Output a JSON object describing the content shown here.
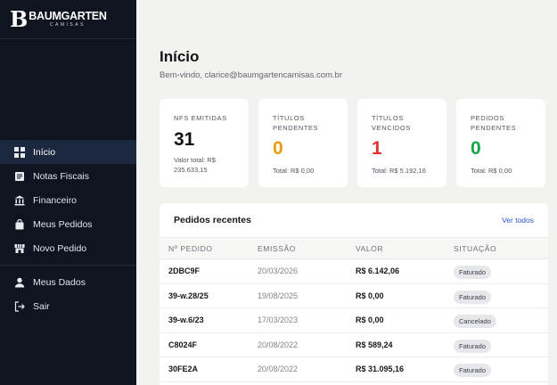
{
  "brand": {
    "mark": "B",
    "name": "BAUMGARTEN",
    "sub": "CAMISAS"
  },
  "nav": {
    "items": [
      {
        "label": "Início",
        "icon": "grid-icon",
        "active": true
      },
      {
        "label": "Notas Fiscais",
        "icon": "document-icon"
      },
      {
        "label": "Financeiro",
        "icon": "bank-icon"
      },
      {
        "label": "Meus Pedidos",
        "icon": "shopping-bag-icon"
      },
      {
        "label": "Novo Pedido",
        "icon": "store-icon"
      }
    ],
    "account": [
      {
        "label": "Meus Dados",
        "icon": "user-icon"
      },
      {
        "label": "Sair",
        "icon": "logout-icon"
      }
    ]
  },
  "main": {
    "title": "Início",
    "welcome": "Bem-vindo, clarice@baumgartencamisas.com.br"
  },
  "cards": [
    {
      "label_1": "NFS EMITIDAS",
      "label_2": "",
      "value": "31",
      "foot_1": "Valor total: R$",
      "foot_2": "235.633,15",
      "color": "#111318"
    },
    {
      "label_1": "TÍTULOS",
      "label_2": "PENDENTES",
      "value": "0",
      "foot_1": "Total: R$ 0,00",
      "foot_2": "",
      "color": "#e89b10"
    },
    {
      "label_1": "TÍTULOS",
      "label_2": "VENCIDOS",
      "value": "1",
      "foot_1": "Total: R$ 5.192,16",
      "foot_2": "",
      "color": "#e03131"
    },
    {
      "label_1": "PEDIDOS",
      "label_2": "PENDENTES",
      "value": "0",
      "foot_1": "Total: R$ 0,00",
      "foot_2": "",
      "color": "#16a34a"
    }
  ],
  "orders": {
    "title": "Pedidos recentes",
    "link": "Ver todos",
    "columns": [
      "Nº PEDIDO",
      "EMISSÃO",
      "VALOR",
      "SITUAÇÃO"
    ],
    "rows": [
      {
        "num": "2DBC9F",
        "date": "20/03/2026",
        "value": "R$ 6.142,06",
        "status": "Faturado"
      },
      {
        "num": "39-w.28/25",
        "date": "19/08/2025",
        "value": "R$ 0,00",
        "status": "Faturado"
      },
      {
        "num": "39-w.6/23",
        "date": "17/03/2023",
        "value": "R$ 0,00",
        "status": "Cancelado"
      },
      {
        "num": "C8024F",
        "date": "20/08/2022",
        "value": "R$ 589,24",
        "status": "Faturado"
      },
      {
        "num": "30FE2A",
        "date": "20/08/2022",
        "value": "R$ 31.095,16",
        "status": "Faturado"
      }
    ]
  }
}
